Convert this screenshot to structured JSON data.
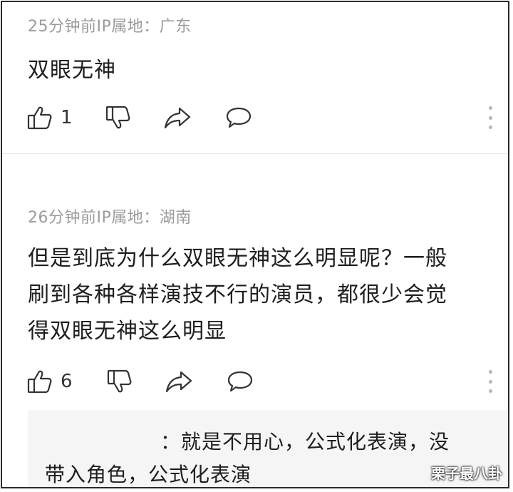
{
  "comments": [
    {
      "meta": "25分钟前IP属地：广东",
      "text": "双眼无神",
      "like_count": "1"
    },
    {
      "meta": "26分钟前IP属地：湖南",
      "text_lines": [
        "但是到底为什么双眼无神这么明显呢？一般",
        "刷到各种各样演技不行的演员，都很少会觉",
        "得双眼无神这么明显"
      ],
      "like_count": "6",
      "reply": {
        "line1": "：就是不用心，公式化表演，没",
        "line2": "带入角色，公式化表演"
      }
    }
  ],
  "icons": [
    "thumbs-up-icon",
    "thumbs-down-icon",
    "share-icon",
    "comment-icon",
    "more-icon"
  ],
  "watermark": "栗子最八卦",
  "colors": {
    "meta": "#9a9a9a",
    "text": "#1e1e1e",
    "icon": "#333333",
    "reply_bg": "#f5f5f5"
  }
}
